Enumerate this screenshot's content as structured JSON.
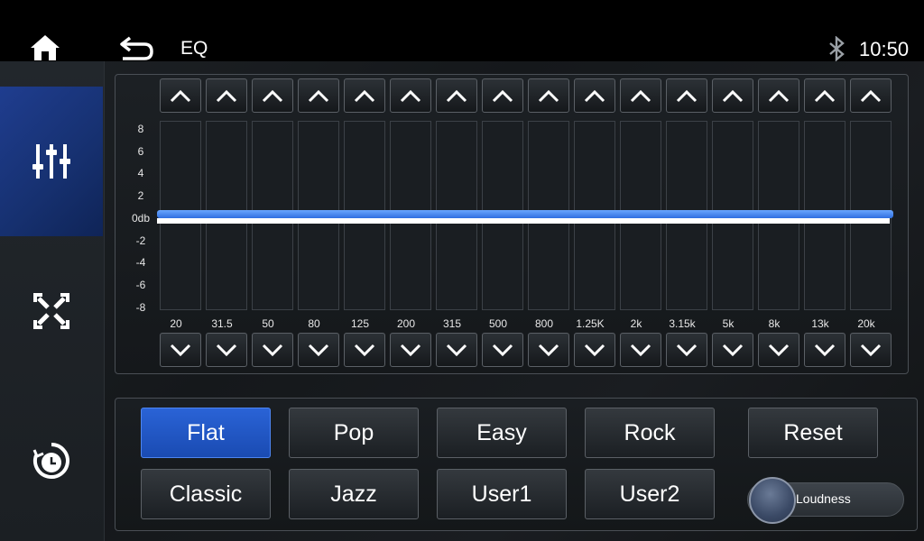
{
  "header": {
    "title": "EQ",
    "time": "10:50",
    "icons": {
      "home": "home-icon",
      "back": "back-arrow-icon",
      "bluetooth": "bluetooth-icon"
    }
  },
  "sidebar": {
    "items": [
      {
        "icon": "equalizer-sliders-icon",
        "active": true
      },
      {
        "icon": "fader-balance-icon",
        "active": false
      },
      {
        "icon": "timer-icon",
        "active": false
      }
    ],
    "accent": "#1f3d8f"
  },
  "eq": {
    "db_labels": [
      "8",
      "6",
      "4",
      "2",
      "0db",
      "-2",
      "-4",
      "-6",
      "-8"
    ],
    "bands": [
      {
        "freq": "20",
        "level": 0
      },
      {
        "freq": "31.5",
        "level": 0
      },
      {
        "freq": "50",
        "level": 0
      },
      {
        "freq": "80",
        "level": 0
      },
      {
        "freq": "125",
        "level": 0
      },
      {
        "freq": "200",
        "level": 0
      },
      {
        "freq": "315",
        "level": 0
      },
      {
        "freq": "500",
        "level": 0
      },
      {
        "freq": "800",
        "level": 0
      },
      {
        "freq": "1.25K",
        "level": 0
      },
      {
        "freq": "2k",
        "level": 0
      },
      {
        "freq": "3.15k",
        "level": 0
      },
      {
        "freq": "5k",
        "level": 0
      },
      {
        "freq": "8k",
        "level": 0
      },
      {
        "freq": "13k",
        "level": 0
      },
      {
        "freq": "20k",
        "level": 0
      }
    ],
    "line_color": "#2f6fe0"
  },
  "presets": {
    "row1": [
      "Flat",
      "Pop",
      "Easy",
      "Rock",
      "Reset"
    ],
    "row2": [
      "Classic",
      "Jazz",
      "User1",
      "User2"
    ],
    "active": "Flat",
    "active_color": "#2a63d6"
  },
  "loudness": {
    "label": "Loudness",
    "on": false
  }
}
